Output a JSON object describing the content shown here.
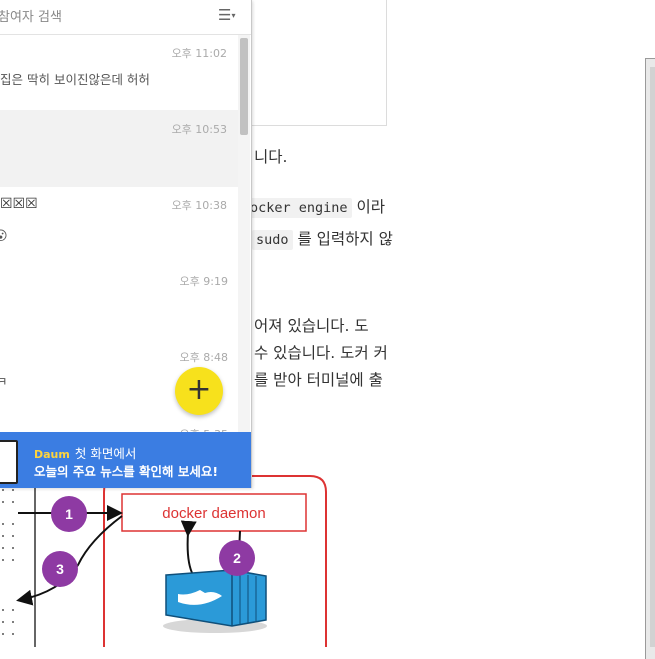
{
  "chat": {
    "search_placeholder": "참여자 검색",
    "menu_icon": "menu-icon",
    "items": [
      {
        "time": "오후 11:02",
        "msg": "집은 딱히 보이진않은데 허허"
      },
      {
        "time": "오후 10:53",
        "msg": ""
      },
      {
        "time": "오후 10:38",
        "msg": "☒☒☒"
      },
      {
        "time": "",
        "msg": "😮"
      },
      {
        "time": "오후 9:19",
        "msg": ""
      },
      {
        "time": "오후 8:48",
        "msg": "ㅋ"
      },
      {
        "time": "오후 5:35",
        "msg": ""
      }
    ],
    "fab_label": "+",
    "banner": {
      "logo": "Daum",
      "line1": "첫 화면에서",
      "line2": "오늘의 주요 뉴스를 확인해 보세요!"
    }
  },
  "article": {
    "line1": "니다.",
    "code1": "ocker engine",
    "line2_suffix": "이라",
    "code2": "sudo",
    "line3_suffix": "를 입력하지 않",
    "para1": "어져 있습니다. 도",
    "para2": "수 있습니다. 도커 커",
    "para3": "를 받아 터미널에 출"
  },
  "diagram": {
    "daemon_label": "docker daemon",
    "step1": "1",
    "step2": "2",
    "step3": "3",
    "colors": {
      "accent": "#dd3333",
      "step": "#8e3aa3",
      "docker": "#2b9ad8"
    }
  }
}
